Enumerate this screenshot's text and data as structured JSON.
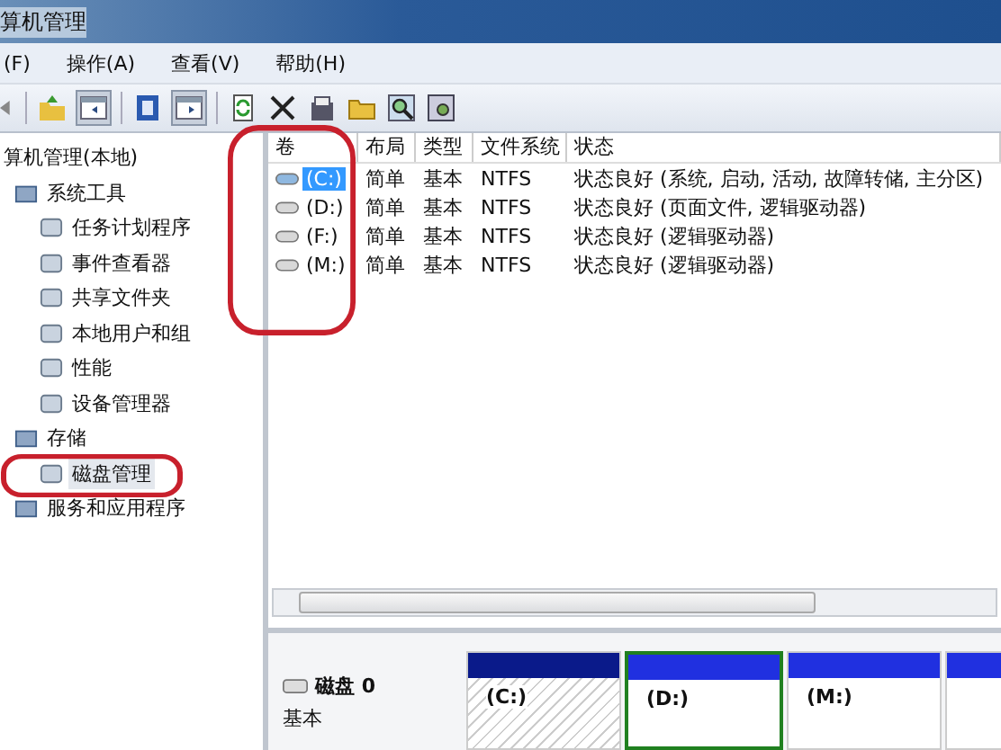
{
  "window": {
    "title": "算机管理"
  },
  "menu": [
    "(F)",
    "操作(A)",
    "查看(V)",
    "帮助(H)"
  ],
  "tree": [
    {
      "label": "算机管理(本地)",
      "selected": false,
      "children": [
        {
          "label": "系统工具",
          "selected": false,
          "children": [
            {
              "label": "任务计划程序",
              "selected": false
            },
            {
              "label": "事件查看器",
              "selected": false
            },
            {
              "label": "共享文件夹",
              "selected": false
            },
            {
              "label": "本地用户和组",
              "selected": false
            },
            {
              "label": "性能",
              "selected": false
            },
            {
              "label": "设备管理器",
              "selected": false
            }
          ]
        },
        {
          "label": "存储",
          "selected": false,
          "children": [
            {
              "label": "磁盘管理",
              "selected": true
            }
          ]
        },
        {
          "label": "服务和应用程序",
          "selected": false
        }
      ]
    }
  ],
  "table": {
    "columns": [
      "卷",
      "布局",
      "类型",
      "文件系统",
      "状态"
    ],
    "rows": [
      {
        "selected": true,
        "cells": [
          "(C:)",
          "简单",
          "基本",
          "NTFS",
          "状态良好 (系统, 启动, 活动, 故障转储, 主分区)"
        ]
      },
      {
        "selected": false,
        "cells": [
          "(D:)",
          "简单",
          "基本",
          "NTFS",
          "状态良好 (页面文件, 逻辑驱动器)"
        ]
      },
      {
        "selected": false,
        "cells": [
          "(F:)",
          "简单",
          "基本",
          "NTFS",
          "状态良好 (逻辑驱动器)"
        ]
      },
      {
        "selected": false,
        "cells": [
          "(M:)",
          "简单",
          "基本",
          "NTFS",
          "状态良好 (逻辑驱动器)"
        ]
      }
    ]
  },
  "disk": {
    "name": "磁盘 0",
    "type": "基本",
    "partitions": [
      {
        "label": "(C:)",
        "kind": "primary",
        "selected": false
      },
      {
        "label": "(D:)",
        "kind": "logical",
        "selected": true
      },
      {
        "label": "(M:)",
        "kind": "logical",
        "selected": false
      },
      {
        "kind": "logical",
        "selected": false
      }
    ]
  }
}
